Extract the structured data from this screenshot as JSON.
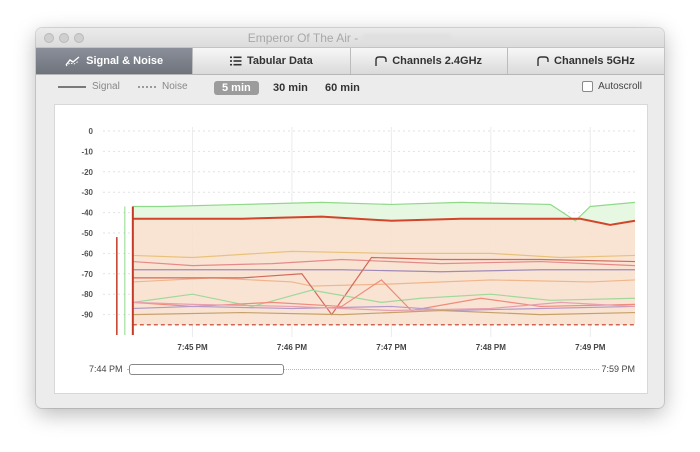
{
  "window": {
    "title": "Emperor Of The Air -"
  },
  "tabs": [
    {
      "label": "Signal & Noise",
      "icon": "signal-chart-icon",
      "active": true
    },
    {
      "label": "Tabular Data",
      "icon": "list-icon",
      "active": false
    },
    {
      "label": "Channels 2.4GHz",
      "icon": "channel-icon",
      "active": false
    },
    {
      "label": "Channels 5GHz",
      "icon": "channel-icon",
      "active": false
    }
  ],
  "legend": {
    "signal_label": "Signal",
    "noise_label": "Noise"
  },
  "ranges": [
    {
      "label": "5 min",
      "active": true
    },
    {
      "label": "30 min",
      "active": false
    },
    {
      "label": "60 min",
      "active": false
    }
  ],
  "autoscroll": {
    "label": "Autoscroll",
    "checked": false
  },
  "timeline": {
    "start": "7:44 PM",
    "end": "7:59 PM"
  },
  "colors": {
    "active_tab": "#7c8089",
    "signal_main": "#d2452b",
    "signal_fill": "#f6dcc8",
    "green": "#8fd98a"
  },
  "chart_data": {
    "type": "line",
    "y_ticks": [
      "0",
      "-10",
      "-20",
      "-30",
      "-40",
      "-50",
      "-60",
      "-70",
      "-80",
      "-90"
    ],
    "ylim": [
      -100,
      0
    ],
    "x_ticks": [
      "7:45 PM",
      "7:46 PM",
      "7:47 PM",
      "7:48 PM",
      "7:49 PM"
    ],
    "x_tick_values": [
      1,
      2,
      3,
      4,
      5
    ],
    "xlim": [
      0.1,
      5.45
    ],
    "noise_level": -95,
    "series": [
      {
        "color": "#8fd98a",
        "x": [
          0.4,
          0.7,
          1.5,
          2.3,
          3.0,
          3.7,
          4.6,
          4.85,
          5.0,
          5.45
        ],
        "y": [
          -37,
          -37,
          -36,
          -35,
          -36,
          -35,
          -36,
          -44,
          -37,
          -35
        ]
      },
      {
        "color": "#d2452b",
        "x": [
          0.4,
          0.7,
          1.5,
          2.3,
          3.0,
          3.7,
          4.5,
          4.9,
          5.2,
          5.45
        ],
        "y": [
          -43,
          -43,
          -43,
          -42,
          -44,
          -43,
          -43,
          -43,
          -46,
          -44
        ]
      },
      {
        "color": "#e8c27a",
        "x": [
          0.4,
          1.0,
          2.0,
          3.0,
          4.0,
          4.7,
          5.45
        ],
        "y": [
          -61,
          -62,
          -59,
          -60,
          -60,
          -62,
          -61
        ]
      },
      {
        "color": "#e48a8a",
        "x": [
          0.4,
          1.0,
          1.8,
          2.5,
          3.5,
          4.5,
          5.45
        ],
        "y": [
          -64,
          -66,
          -65,
          -63,
          -65,
          -64,
          -66
        ]
      },
      {
        "color": "#a08ab7",
        "x": [
          0.4,
          1.5,
          2.5,
          3.5,
          4.5,
          5.45
        ],
        "y": [
          -68,
          -68,
          -68,
          -69,
          -68,
          -68
        ]
      },
      {
        "color": "#f0b58a",
        "x": [
          0.4,
          1.2,
          2.0,
          2.2,
          3.0,
          4.0,
          5.0,
          5.45
        ],
        "y": [
          -74,
          -72,
          -74,
          -76,
          -75,
          -73,
          -74,
          -73
        ]
      },
      {
        "color": "#d26a5a",
        "x": [
          0.4,
          1.5,
          2.1,
          2.4,
          2.8,
          3.5,
          4.5,
          5.45
        ],
        "y": [
          -72,
          -72,
          -70,
          -90,
          -62,
          -63,
          -63,
          -64
        ]
      },
      {
        "color": "#9fd89a",
        "x": [
          0.4,
          1.0,
          1.6,
          2.2,
          2.9,
          3.3,
          4.0,
          4.6,
          5.45
        ],
        "y": [
          -84,
          -80,
          -86,
          -78,
          -84,
          -82,
          -80,
          -83,
          -82
        ]
      },
      {
        "color": "#f08a7a",
        "x": [
          0.4,
          1.0,
          1.8,
          2.5,
          2.9,
          3.2,
          3.9,
          4.5,
          5.45
        ],
        "y": [
          -84,
          -86,
          -84,
          -86,
          -73,
          -88,
          -82,
          -86,
          -85
        ]
      },
      {
        "color": "#b59ac9",
        "x": [
          0.4,
          1.0,
          2.0,
          3.0,
          3.6,
          4.5,
          5.45
        ],
        "y": [
          -87,
          -86,
          -87,
          -86,
          -88,
          -87,
          -86
        ]
      },
      {
        "color": "#c6a06a",
        "x": [
          0.4,
          1.5,
          2.5,
          3.5,
          4.5,
          5.45
        ],
        "y": [
          -90,
          -89,
          -90,
          -88,
          -90,
          -89
        ]
      },
      {
        "color": "#e69fb0",
        "x": [
          0.4,
          1.0,
          2.0,
          3.0,
          4.0,
          4.7,
          5.45
        ],
        "y": [
          -84,
          -85,
          -86,
          -88,
          -87,
          -84,
          -86
        ]
      }
    ]
  }
}
